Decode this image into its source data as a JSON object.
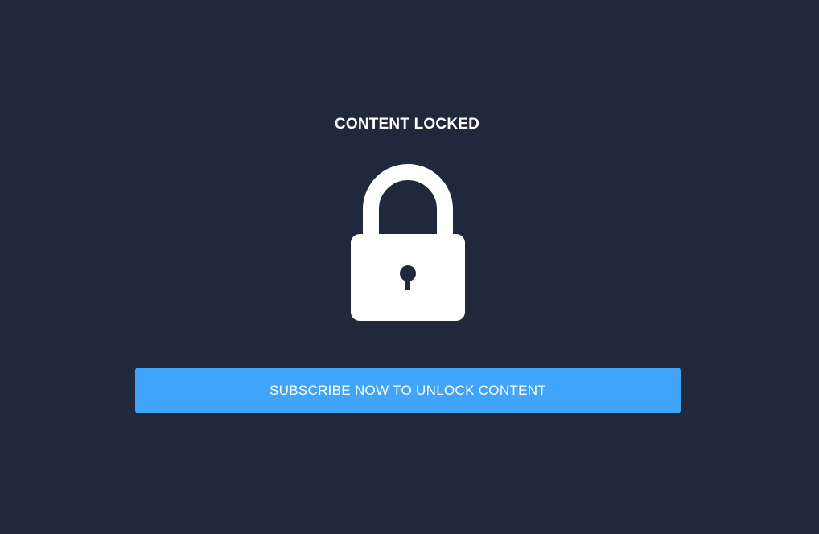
{
  "locked": {
    "title": "CONTENT LOCKED",
    "icon": "padlock-icon",
    "cta_label": "SUBSCRIBE NOW TO UNLOCK CONTENT"
  },
  "colors": {
    "background": "#20283c",
    "accent": "#40a5fa",
    "text": "#ffffff"
  }
}
